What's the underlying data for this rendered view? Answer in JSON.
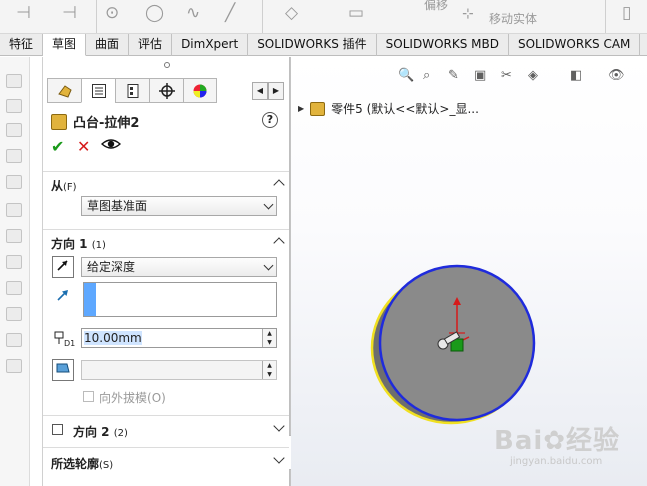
{
  "tabs": [
    {
      "label": "特征",
      "active": false
    },
    {
      "label": "草图",
      "active": true
    },
    {
      "label": "曲面",
      "active": false
    },
    {
      "label": "评估",
      "active": false
    },
    {
      "label": "DimXpert",
      "active": false
    },
    {
      "label": "SOLIDWORKS 插件",
      "active": false
    },
    {
      "label": "SOLIDWORKS MBD",
      "active": false
    },
    {
      "label": "SOLIDWORKS CAM",
      "active": false
    }
  ],
  "toolbar": {
    "partial_text_1": "偏移",
    "move_entities": "移动实体"
  },
  "property_manager": {
    "tab_icons": [
      "feature-manager-icon",
      "property-manager-icon",
      "configuration-manager-icon",
      "dimxpert-manager-icon",
      "display-manager-icon"
    ],
    "title": "凸台-拉伸2",
    "help": "?",
    "ok_symbol": "✔",
    "cancel_symbol": "✕",
    "from_section": {
      "label": "从",
      "hotkey": "(F)",
      "value": "草图基准面"
    },
    "direction1": {
      "label": "方向 1",
      "hotkey": "(1)",
      "end_condition": "给定深度",
      "depth": "10.00mm",
      "draft_outward": "向外拔模",
      "draft_hotkey": "(O)"
    },
    "direction2": {
      "label": "方向 2",
      "hotkey": "(2)"
    },
    "selected_contours": {
      "label": "所选轮廓",
      "hotkey": "(S)"
    }
  },
  "graphics": {
    "tree_root": "零件5  (默认<<默认>_显..."
  },
  "colors": {
    "accent_blue": "#1f2bdc",
    "edge_yellow": "#f0e020",
    "face_gray": "#8a8a8a",
    "cancel_red": "#d61b1b",
    "ok_green": "#1a9a1a"
  }
}
